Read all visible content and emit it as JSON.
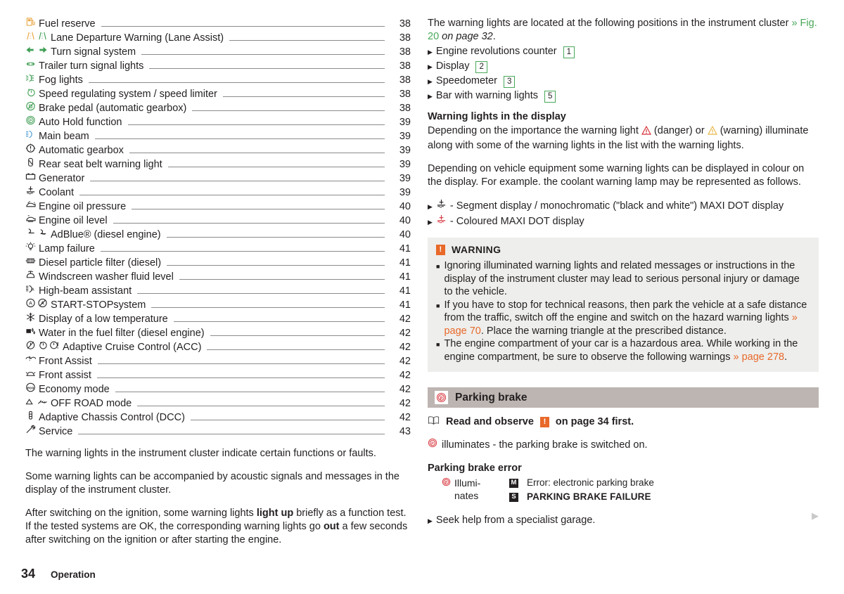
{
  "footer": {
    "page_number": "34",
    "section": "Operation"
  },
  "toc": {
    "entries": [
      {
        "icons": [
          "fuel-pump-icon"
        ],
        "label": "Fuel reserve",
        "page": "38"
      },
      {
        "icons": [
          "lane-assist-amber-icon",
          "lane-assist-green-icon"
        ],
        "label": "Lane Departure Warning (Lane Assist)",
        "page": "38"
      },
      {
        "icons": [
          "arrow-left-green-icon",
          "arrow-right-green-icon"
        ],
        "label": "Turn signal system",
        "page": "38"
      },
      {
        "icons": [
          "trailer-turn-signal-icon"
        ],
        "label": "Trailer turn signal lights",
        "page": "38"
      },
      {
        "icons": [
          "fog-lights-icon"
        ],
        "label": "Fog lights",
        "page": "38"
      },
      {
        "icons": [
          "speed-limiter-icon"
        ],
        "label": "Speed regulating system / speed limiter",
        "page": "38"
      },
      {
        "icons": [
          "brake-pedal-icon"
        ],
        "label": "Brake pedal (automatic gearbox)",
        "page": "38"
      },
      {
        "icons": [
          "auto-hold-icon"
        ],
        "label": "Auto Hold function",
        "page": "39"
      },
      {
        "icons": [
          "main-beam-icon"
        ],
        "label": "Main beam",
        "page": "39"
      },
      {
        "icons": [
          "automatic-gearbox-icon"
        ],
        "label": "Automatic gearbox",
        "page": "39"
      },
      {
        "icons": [
          "seat-belt-icon"
        ],
        "label": "Rear seat belt warning light",
        "page": "39"
      },
      {
        "icons": [
          "generator-icon"
        ],
        "label": "Generator",
        "page": "39"
      },
      {
        "icons": [
          "coolant-icon"
        ],
        "label": "Coolant",
        "page": "39"
      },
      {
        "icons": [
          "oil-pressure-icon"
        ],
        "label": "Engine oil pressure",
        "page": "40"
      },
      {
        "icons": [
          "oil-level-icon"
        ],
        "label": "Engine oil level",
        "page": "40"
      },
      {
        "icons": [
          "adblue-icon",
          "adblue-alt-icon"
        ],
        "label": "AdBlue® (diesel engine)",
        "page": "40"
      },
      {
        "icons": [
          "lamp-failure-icon"
        ],
        "label": "Lamp failure",
        "page": "41"
      },
      {
        "icons": [
          "particle-filter-icon"
        ],
        "label": "Diesel particle filter (diesel)",
        "page": "41"
      },
      {
        "icons": [
          "washer-fluid-icon"
        ],
        "label": "Windscreen washer fluid level",
        "page": "41"
      },
      {
        "icons": [
          "high-beam-assist-icon"
        ],
        "label": "High-beam assistant",
        "page": "41"
      },
      {
        "icons": [
          "start-stop-icon",
          "start-stop-off-icon"
        ],
        "label": "START-STOPsystem",
        "page": "41"
      },
      {
        "icons": [
          "snowflake-icon"
        ],
        "label": "Display of a low temperature",
        "page": "42"
      },
      {
        "icons": [
          "water-fuel-filter-icon"
        ],
        "label": "Water in the fuel filter (diesel engine)",
        "page": "42"
      },
      {
        "icons": [
          "acc-icon-1",
          "acc-icon-2",
          "acc-icon-3"
        ],
        "label": "Adaptive Cruise Control (ACC)",
        "page": "42"
      },
      {
        "icons": [
          "front-assist-icon"
        ],
        "label": "Front Assist",
        "page": "42"
      },
      {
        "icons": [
          "front-assist-alt-icon"
        ],
        "label": "Front assist",
        "page": "42"
      },
      {
        "icons": [
          "eco-icon"
        ],
        "label": "Economy mode",
        "page": "42"
      },
      {
        "icons": [
          "offroad-icon",
          "offroad-alt-icon"
        ],
        "label": "OFF ROAD mode",
        "page": "42"
      },
      {
        "icons": [
          "dcc-icon"
        ],
        "label": "Adaptive Chassis Control (DCC)",
        "page": "42"
      },
      {
        "icons": [
          "service-icon"
        ],
        "label": "Service",
        "page": "43"
      }
    ]
  },
  "left_body": {
    "p1": "The warning lights in the instrument cluster indicate certain functions or faults.",
    "p2": "Some warning lights can be accompanied by acoustic signals and messages in the display of the instrument cluster.",
    "p3_part1": "After switching on the ignition, some warning lights ",
    "p3_bold1": "light up",
    "p3_part2": " briefly as a function test. If the tested systems are OK, the corresponding warning lights go ",
    "p3_bold2": "out",
    "p3_part3": " a few seconds after switching on the ignition or after starting the engine."
  },
  "right": {
    "intro_part1": "The warning lights are located at the following positions in the instrument cluster ",
    "intro_link": "» Fig. 20",
    "intro_ital": " on page 32",
    "intro_end": ".",
    "positions": [
      {
        "label": "Engine revolutions counter",
        "num": "1"
      },
      {
        "label": "Display",
        "num": "2"
      },
      {
        "label": "Speedometer",
        "num": "3"
      },
      {
        "label": "Bar with warning lights",
        "num": "5"
      }
    ],
    "display_heading": "Warning lights in the display",
    "display_p1_a": "Depending on the importance the warning light ",
    "display_p1_b": " (danger) or ",
    "display_p1_c": " (warning) illuminate along with some of the warning lights in the list with the warning lights.",
    "display_p2": "Depending on vehicle equipment some warning lights can be displayed in colour on the display. For example. the coolant warning lamp may be represented as follows.",
    "coolant_bullets": [
      {
        "icon": "coolant-black-icon",
        "text": "- Segment display / monochromatic (\"black and white\") MAXI DOT display"
      },
      {
        "icon": "coolant-red-icon",
        "text": "- Coloured MAXI DOT display"
      }
    ],
    "warning_box": {
      "title": "WARNING",
      "items": [
        {
          "text": "Ignoring illuminated warning lights and related messages or instructions in the display of the instrument cluster may lead to serious personal injury or damage to the vehicle."
        },
        {
          "text_a": "If you have to stop for technical reasons, then park the vehicle at a safe distance from the traffic, switch off the engine and switch on the hazard warning lights ",
          "link": "» page 70",
          "text_b": ". Place the warning triangle at the prescribed distance."
        },
        {
          "text_a": "The engine compartment of your car is a hazardous area. While working in the engine compartment, be sure to observe the following warnings ",
          "link": "» page 278",
          "text_b": "."
        }
      ]
    },
    "parking_brake": {
      "heading": "Parking brake",
      "read_observe_a": "Read and observe",
      "read_observe_b": "on page 34 first.",
      "illuminates": "illuminates - the parking brake is switched on.",
      "error_title": "Parking brake error",
      "error_col1": "Illuminates",
      "error_messages": [
        {
          "badge": "M",
          "text": "Error: electronic parking brake",
          "bold": false
        },
        {
          "badge": "S",
          "text": "PARKING BRAKE FAILURE",
          "bold": true
        }
      ],
      "action": "Seek help from a specialist garage."
    }
  },
  "colors": {
    "green_link": "#4aa85a",
    "orange_link": "#e8692a",
    "warn_box_bg": "#eeeeec",
    "section_head_bg": "#bdb5b2",
    "red_icon": "#d6323a",
    "amber_icon": "#e8a33d",
    "green_icon": "#3f9e54"
  }
}
